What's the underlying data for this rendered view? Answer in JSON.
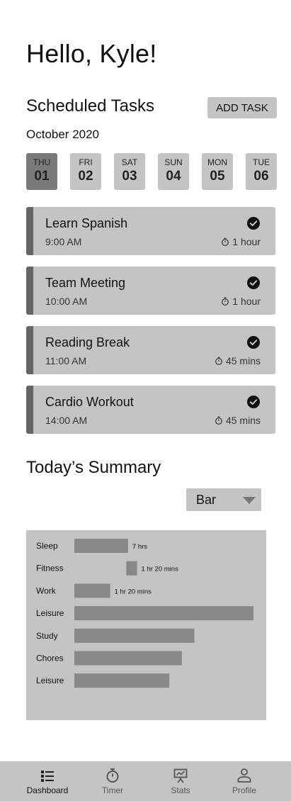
{
  "greeting": "Hello, Kyle!",
  "schedule": {
    "title": "Scheduled Tasks",
    "add_label": "ADD TASK",
    "month": "October 2020",
    "days": [
      {
        "dow": "THU",
        "num": "01",
        "active": true
      },
      {
        "dow": "FRI",
        "num": "02",
        "active": false
      },
      {
        "dow": "SAT",
        "num": "03",
        "active": false
      },
      {
        "dow": "SUN",
        "num": "04",
        "active": false
      },
      {
        "dow": "MON",
        "num": "05",
        "active": false
      },
      {
        "dow": "TUE",
        "num": "06",
        "active": false
      }
    ]
  },
  "tasks": [
    {
      "name": "Learn Spanish",
      "time": "9:00 AM",
      "duration": "1 hour",
      "done": true
    },
    {
      "name": "Team Meeting",
      "time": "10:00 AM",
      "duration": "1 hour",
      "done": true
    },
    {
      "name": "Reading Break",
      "time": "11:00 AM",
      "duration": "45 mins",
      "done": true
    },
    {
      "name": "Cardio Workout",
      "time": "14:00 AM",
      "duration": "45 mins",
      "done": true
    }
  ],
  "summary": {
    "title": "Today’s Summary",
    "chart_type_selected": "Bar"
  },
  "chart_data": {
    "type": "bar",
    "orientation": "horizontal",
    "categories": [
      "Sleep",
      "Fitness",
      "Work",
      "Leisure",
      "Study",
      "Chores",
      "Leisure"
    ],
    "bars": [
      {
        "start": 0,
        "end": 0.3,
        "label": "7 hrs"
      },
      {
        "start": 0.29,
        "end": 0.35,
        "label": "1 hr 20 mins"
      },
      {
        "start": 0,
        "end": 0.2,
        "label": "1 hr  20 mins"
      },
      {
        "start": 0,
        "end": 1.0,
        "label": ""
      },
      {
        "start": 0,
        "end": 0.67,
        "label": ""
      },
      {
        "start": 0,
        "end": 0.6,
        "label": ""
      },
      {
        "start": 0,
        "end": 0.53,
        "label": ""
      }
    ],
    "grid": false,
    "legend": "none"
  },
  "nav": {
    "items": [
      {
        "label": "Dashboard",
        "icon": "list-icon",
        "active": true
      },
      {
        "label": "Timer",
        "icon": "stopwatch-icon",
        "active": false
      },
      {
        "label": "Stats",
        "icon": "presentation-chart-icon",
        "active": false
      },
      {
        "label": "Profile",
        "icon": "person-icon",
        "active": false
      }
    ]
  },
  "colors": {
    "surface": "#c4c4c4",
    "accent": "#666666",
    "active_day": "#7a7a7a",
    "bar": "#888888"
  }
}
